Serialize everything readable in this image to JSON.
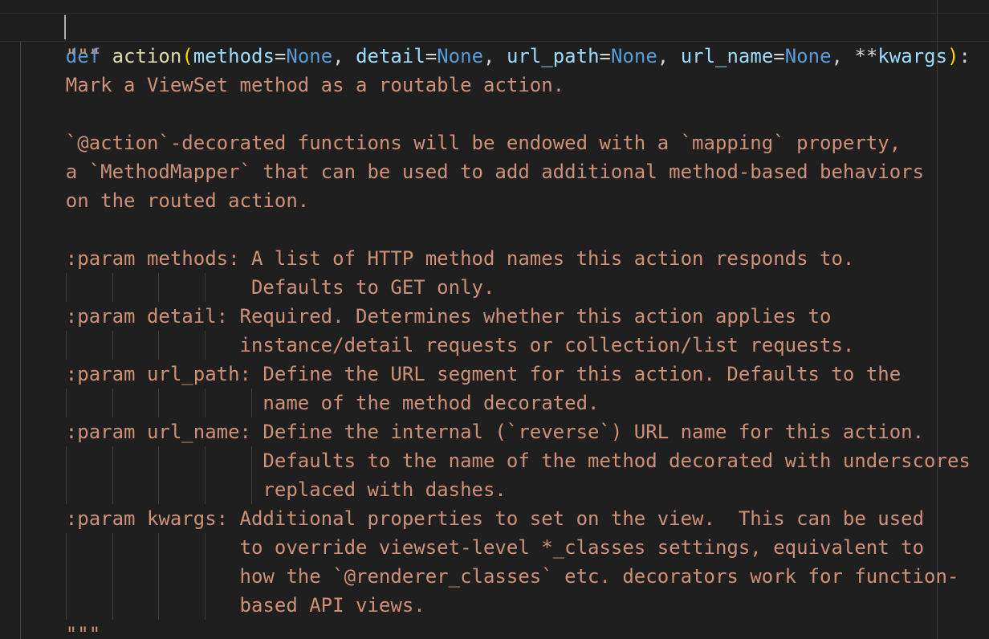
{
  "editor": {
    "language": "python",
    "colors": {
      "background": "#1f1f1f",
      "keyword": "#569cd6",
      "function": "#dcdcaa",
      "parameter": "#9cdcfe",
      "constant": "#569cd6",
      "operator": "#d4d4d4",
      "bracket": "#ffd700",
      "docstring": "#ce9178"
    },
    "signature": {
      "def_keyword": "def",
      "function_name": "action",
      "open_paren": "(",
      "close_paren": ")",
      "colon": ":",
      "params": [
        {
          "name": "methods",
          "eq": "=",
          "default": "None",
          "sep": ", "
        },
        {
          "name": "detail",
          "eq": "=",
          "default": "None",
          "sep": ", "
        },
        {
          "name": "url_path",
          "eq": "=",
          "default": "None",
          "sep": ", "
        },
        {
          "name": "url_name",
          "eq": "=",
          "default": "None",
          "sep": ", "
        }
      ],
      "kwargs_op": "**",
      "kwargs_name": "kwargs"
    },
    "docstring_lines": [
      "    \"\"\"",
      "    Mark a ViewSet method as a routable action.",
      "",
      "    `@action`-decorated functions will be endowed with a `mapping` property,",
      "    a `MethodMapper` that can be used to add additional method-based behaviors",
      "    on the routed action.",
      "",
      "    :param methods: A list of HTTP method names this action responds to.",
      "                    Defaults to GET only.",
      "    :param detail: Required. Determines whether this action applies to",
      "                   instance/detail requests or collection/list requests.",
      "    :param url_path: Define the URL segment for this action. Defaults to the",
      "                     name of the method decorated.",
      "    :param url_name: Define the internal (`reverse`) URL name for this action.",
      "                     Defaults to the name of the method decorated with underscores",
      "                     replaced with dashes.",
      "    :param kwargs: Additional properties to set on the view.  This can be used",
      "                   to override viewset-level *_classes settings, equivalent to",
      "                   how the `@renderer_classes` etc. decorators work for function-",
      "                   based API views.",
      "    \"\"\""
    ]
  }
}
